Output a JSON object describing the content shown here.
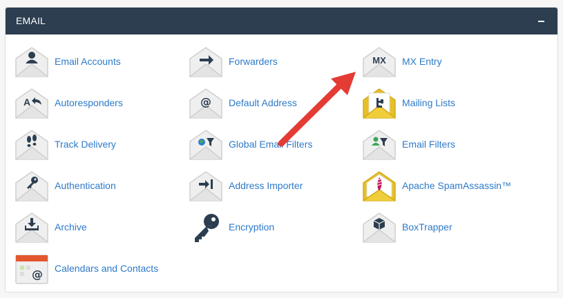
{
  "panel": {
    "title": "EMAIL",
    "collapse_symbol": "minus-icon"
  },
  "items": [
    {
      "label": "Email Accounts",
      "icon": "email-accounts-icon"
    },
    {
      "label": "Forwarders",
      "icon": "forwarders-icon"
    },
    {
      "label": "MX Entry",
      "icon": "mx-entry-icon",
      "icon_text": "MX"
    },
    {
      "label": "Autoresponders",
      "icon": "autoresponders-icon",
      "icon_text": "A"
    },
    {
      "label": "Default Address",
      "icon": "default-address-icon"
    },
    {
      "label": "Mailing Lists",
      "icon": "mailing-lists-icon"
    },
    {
      "label": "Track Delivery",
      "icon": "track-delivery-icon"
    },
    {
      "label": "Global Email Filters",
      "icon": "global-email-filters-icon"
    },
    {
      "label": "Email Filters",
      "icon": "email-filters-icon"
    },
    {
      "label": "Authentication",
      "icon": "authentication-icon"
    },
    {
      "label": "Address Importer",
      "icon": "address-importer-icon"
    },
    {
      "label": "Apache SpamAssassin™",
      "icon": "spamassassin-icon"
    },
    {
      "label": "Archive",
      "icon": "archive-icon"
    },
    {
      "label": "Encryption",
      "icon": "encryption-icon"
    },
    {
      "label": "BoxTrapper",
      "icon": "boxtrapper-icon"
    },
    {
      "label": "Calendars and Contacts",
      "icon": "calendars-contacts-icon"
    }
  ],
  "colors": {
    "header_bg": "#2c3e50",
    "link": "#2c7ac9",
    "icon_envelope": "#eeeeee",
    "icon_stroke": "#c8c8c8",
    "icon_glyph": "#2c3e50",
    "highlight_yellow": "#e6c02a",
    "annotation_arrow": "#e43b35"
  }
}
